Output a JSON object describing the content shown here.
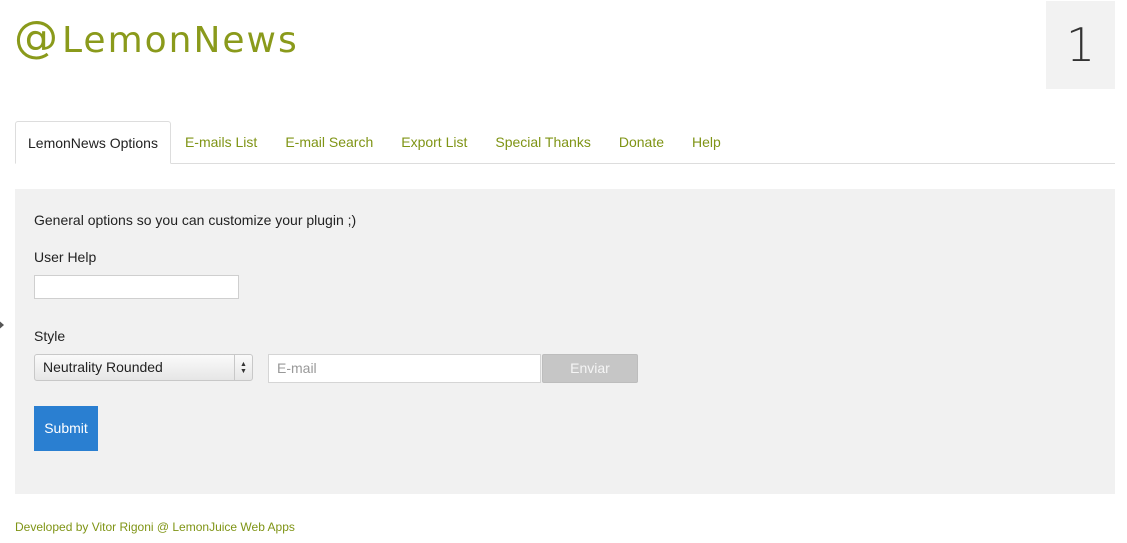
{
  "brand": {
    "at_symbol": "@",
    "name": "LemonNews",
    "color": "#8a9a1b"
  },
  "count_badge": "1",
  "tabs": [
    {
      "label": "LemonNews Options",
      "active": true
    },
    {
      "label": "E-mails List",
      "active": false
    },
    {
      "label": "E-mail Search",
      "active": false
    },
    {
      "label": "Export List",
      "active": false
    },
    {
      "label": "Special Thanks",
      "active": false
    },
    {
      "label": "Donate",
      "active": false
    },
    {
      "label": "Help",
      "active": false
    }
  ],
  "panel": {
    "description": "General options so you can customize your plugin ;)",
    "user_help_label": "User Help",
    "user_help_value": "",
    "style_label": "Style",
    "style_selected": "Neutrality Rounded",
    "email_placeholder": "E-mail",
    "enviar_label": "Enviar",
    "submit_label": "Submit"
  },
  "footer": "Developed by Vitor Rigoni @ LemonJuice Web Apps",
  "colors": {
    "accent_green": "#7f9415",
    "submit_blue": "#2a7fd1",
    "panel_bg": "#f1f1f1"
  }
}
